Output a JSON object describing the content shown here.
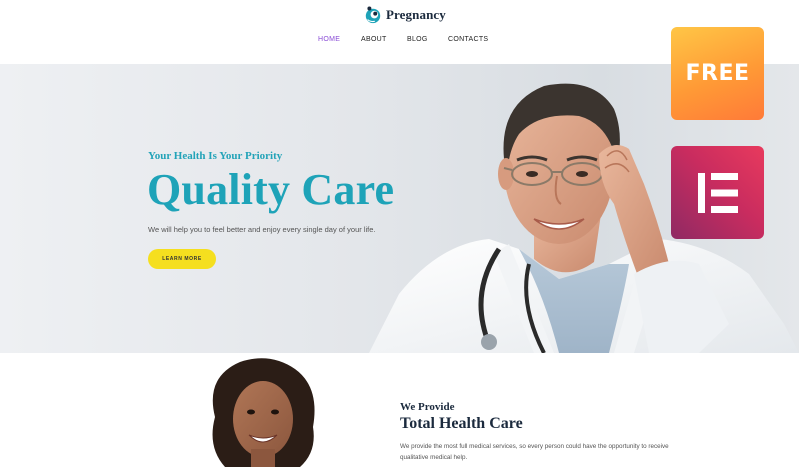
{
  "brand": {
    "name": "Pregnancy",
    "logo_icon": "pregnancy-logo-icon",
    "accent": "#1ea3b8"
  },
  "nav": {
    "items": [
      {
        "label": "HOME",
        "active": true
      },
      {
        "label": "ABOUT",
        "active": false
      },
      {
        "label": "BLOG",
        "active": false
      },
      {
        "label": "CONTACTS",
        "active": false
      }
    ],
    "active_color": "#8a4cd6"
  },
  "hero": {
    "eyebrow": "Your Health Is Your Priority",
    "title": "Quality Care",
    "description": "We will help you to feel better and enjoy every single day of your life.",
    "button_label": "LEARN MORE",
    "button_color": "#f5df1f",
    "image": "doctor-portrait"
  },
  "badges": {
    "free_label": "FREE",
    "free_color": "#ff9a36",
    "elementor_icon": "elementor-logo-icon",
    "elementor_color": "#c92c5f"
  },
  "provide": {
    "eyebrow": "We Provide",
    "title": "Total Health Care",
    "text": "We provide the most full medical services, so every person could have the opportunity to receive qualitative medical help.",
    "image": "woman-portrait"
  }
}
